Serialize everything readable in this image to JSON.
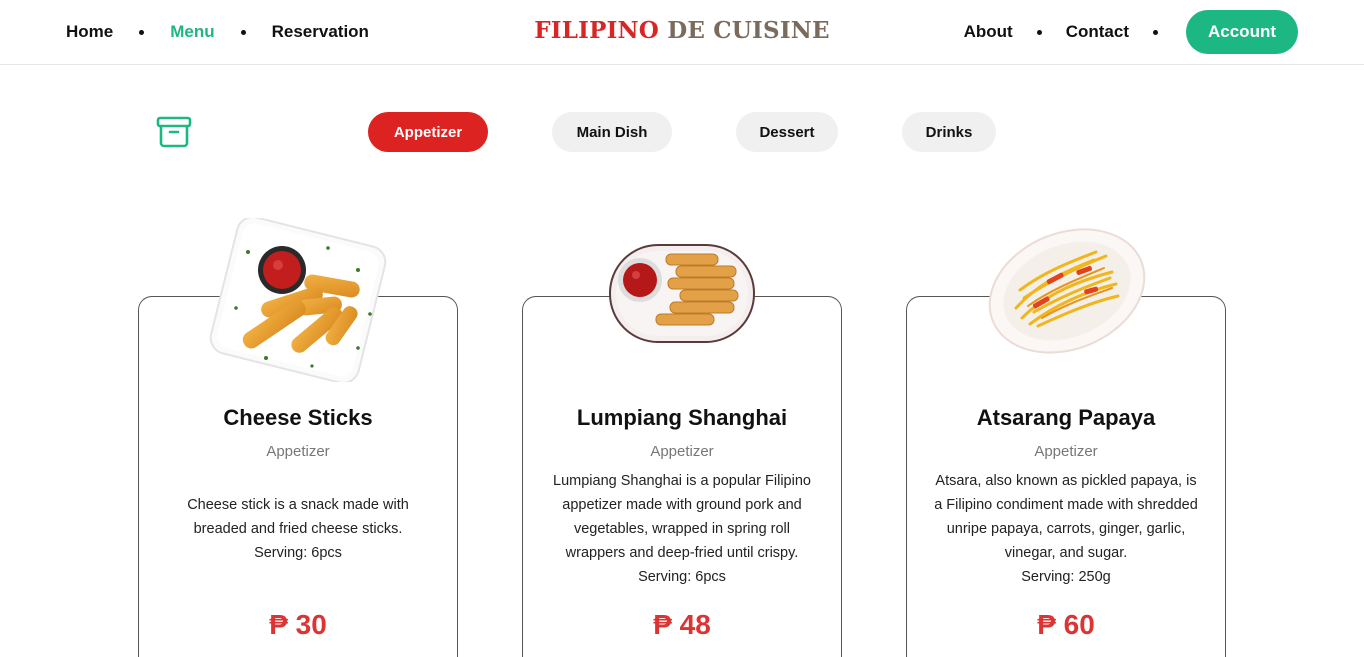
{
  "nav": {
    "home": "Home",
    "menu": "Menu",
    "reservation": "Reservation",
    "about": "About",
    "contact": "Contact",
    "account": "Account"
  },
  "brand": {
    "part1": "FILIPINO",
    "part2": "DE CUISINE"
  },
  "colors": {
    "accent_green": "#1db784",
    "accent_red": "#dd2222",
    "brand_red": "#d82525",
    "brand_brown": "#7a6b5d"
  },
  "categories": [
    "Appetizer",
    "Main Dish",
    "Dessert",
    "Drinks"
  ],
  "active_category": "Appetizer",
  "icons": {
    "archive": "archive-box-icon"
  },
  "items": [
    {
      "name": "Cheese Sticks",
      "category": "Appetizer",
      "description": "Cheese stick is a snack made with breaded and fried cheese sticks.",
      "serving": "Serving: 6pcs",
      "price": "₱ 30",
      "image": "cheese-sticks-plate"
    },
    {
      "name": "Lumpiang Shanghai",
      "category": "Appetizer",
      "description": "Lumpiang Shanghai is a popular Filipino appetizer made with ground pork and vegetables, wrapped in spring roll wrappers and deep-fried until crispy.",
      "serving": "Serving: 6pcs",
      "price": "₱ 48",
      "image": "lumpia-plate"
    },
    {
      "name": "Atsarang Papaya",
      "category": "Appetizer",
      "description": "Atsara, also known as pickled papaya, is a Filipino condiment made with shredded unripe papaya, carrots, ginger, garlic, vinegar, and sugar.",
      "serving": "Serving: 250g",
      "price": "₱ 60",
      "image": "atsara-plate"
    }
  ]
}
